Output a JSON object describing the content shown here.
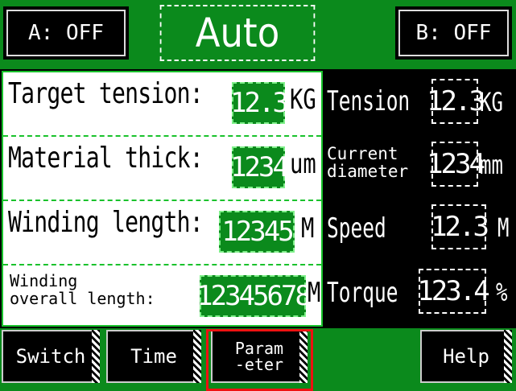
{
  "header": {
    "a_button": "A: OFF",
    "mode": "Auto",
    "b_button": "B: OFF"
  },
  "left_panel": {
    "rows": [
      {
        "label": "Target tension:",
        "value": "12.3",
        "unit": "KG"
      },
      {
        "label": "Material thick:",
        "value": "1234",
        "unit": "um"
      },
      {
        "label": "Winding length:",
        "value": "12345",
        "unit": "M"
      },
      {
        "label": "Winding\noverall length:",
        "value": "12345678",
        "unit": "M"
      }
    ]
  },
  "right_panel": {
    "rows": [
      {
        "label": "Tension",
        "value": "12.3",
        "unit": "KG"
      },
      {
        "label": "Current\ndiameter",
        "value": "1234",
        "unit": "mm"
      },
      {
        "label": "Speed",
        "value": "12.3",
        "unit": "M"
      },
      {
        "label": "Torque",
        "value": "123.4",
        "unit": "%"
      }
    ]
  },
  "footer": {
    "switch": "Switch",
    "time": "Time",
    "parameter": "Param\n-eter",
    "help": "Help"
  }
}
